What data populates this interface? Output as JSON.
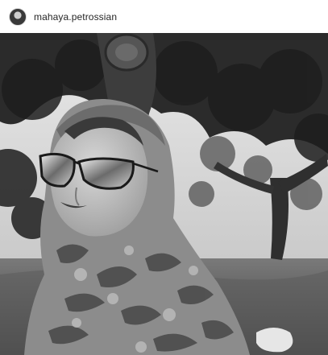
{
  "post": {
    "username": "mahaya.petrossian",
    "avatar_icon": "profile-avatar",
    "photo_style": "black-and-white"
  }
}
